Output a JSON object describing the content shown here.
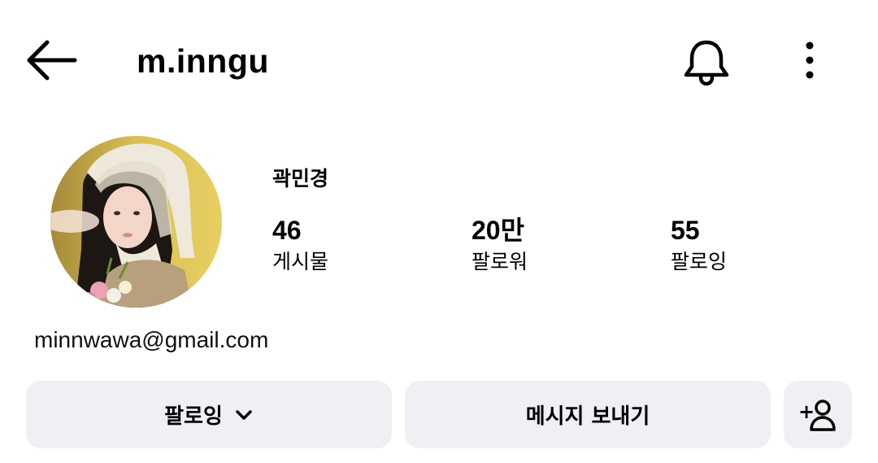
{
  "header": {
    "username": "m.inngu",
    "back_icon": "arrow-left-icon",
    "bell_icon": "bell-icon",
    "more_icon": "more-vertical-icon"
  },
  "profile": {
    "display_name": "곽민경",
    "bio_email": "minnwawa@gmail.com",
    "stats": [
      {
        "count": "46",
        "label": "게시물"
      },
      {
        "count": "20만",
        "label": "팔로워"
      },
      {
        "count": "55",
        "label": "팔로잉"
      }
    ]
  },
  "actions": {
    "following_label": "팔로잉",
    "following_icon": "chevron-down-icon",
    "message_label": "메시지 보내기",
    "add_user_icon": "add-user-icon",
    "add_user_label": "+"
  },
  "colors": {
    "button_bg": "#eff0f3",
    "text": "#000000"
  }
}
